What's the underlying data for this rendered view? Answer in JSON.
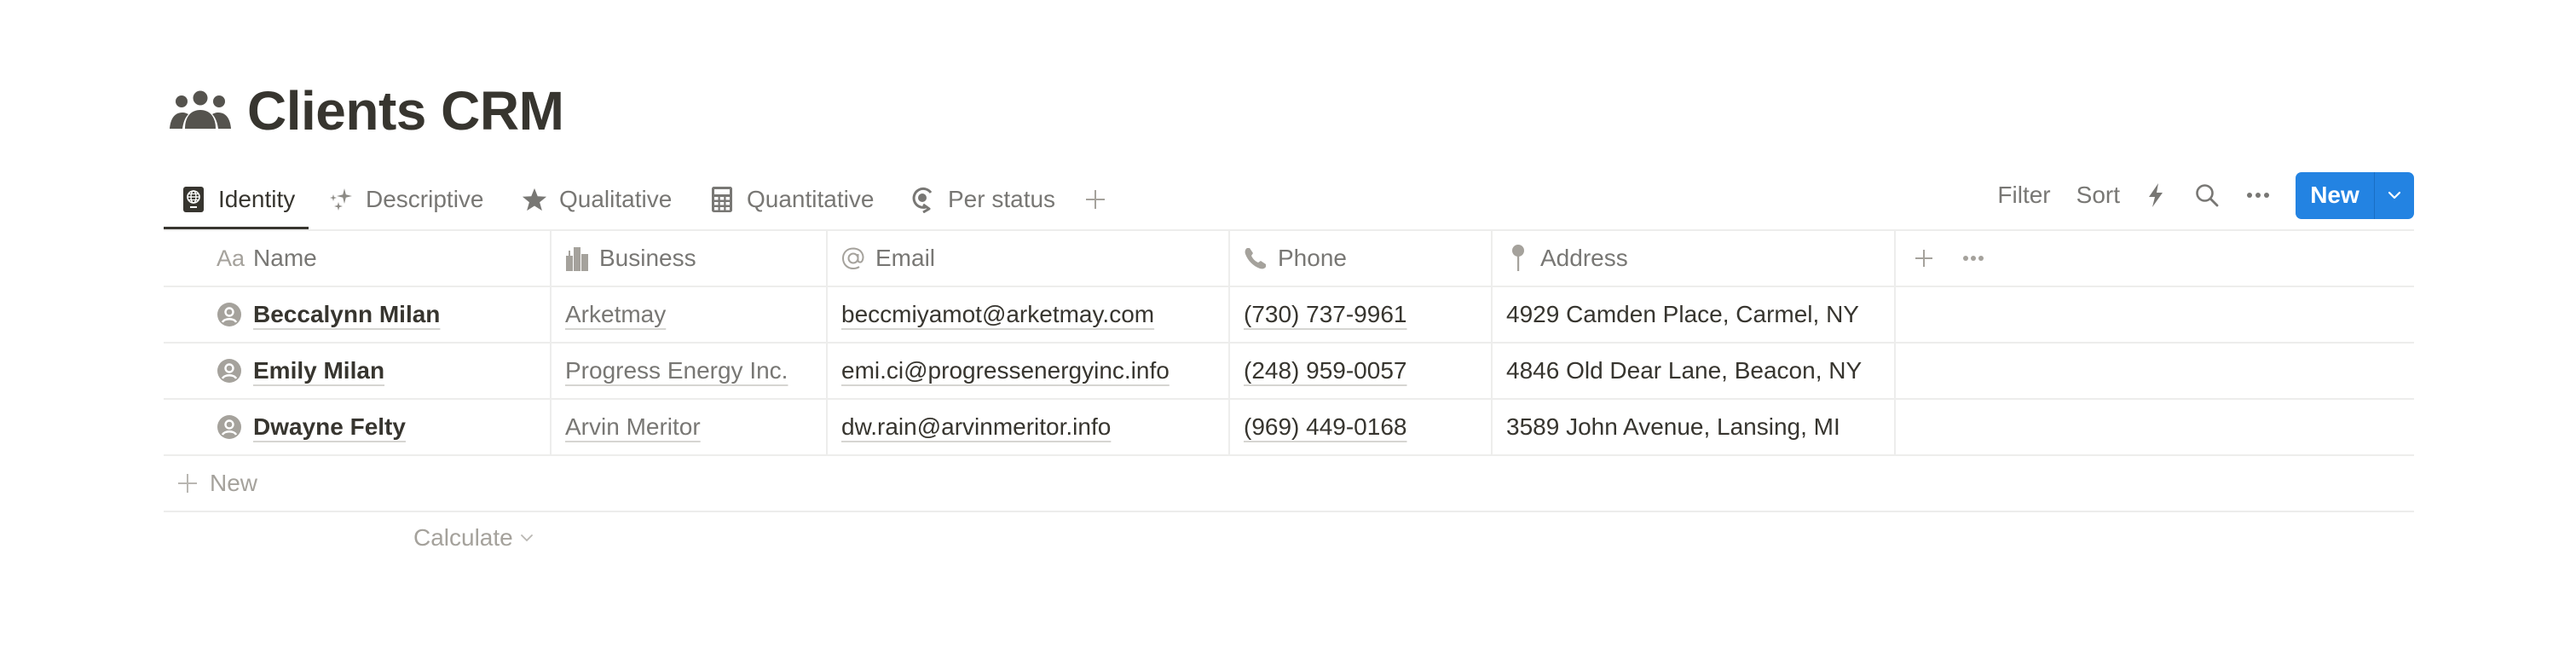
{
  "page": {
    "title": "Clients CRM",
    "title_icon": "people-group-icon"
  },
  "tabs": [
    {
      "label": "Identity",
      "icon": "passport-icon",
      "active": true
    },
    {
      "label": "Descriptive",
      "icon": "sparkles-icon",
      "active": false
    },
    {
      "label": "Qualitative",
      "icon": "star-icon",
      "active": false
    },
    {
      "label": "Quantitative",
      "icon": "calculator-icon",
      "active": false
    },
    {
      "label": "Per status",
      "icon": "status-cycle-icon",
      "active": false
    }
  ],
  "toolbar": {
    "filter_label": "Filter",
    "sort_label": "Sort",
    "automation_icon": "lightning-icon",
    "search_icon": "search-icon",
    "more_icon": "ellipsis-icon",
    "new_label": "New",
    "new_dropdown_icon": "chevron-down-icon",
    "accent_color": "#2383e2"
  },
  "table": {
    "columns": [
      {
        "label": "Name",
        "icon": "Aa"
      },
      {
        "label": "Business",
        "icon": "building-icon"
      },
      {
        "label": "Email",
        "icon": "at-sign-icon"
      },
      {
        "label": "Phone",
        "icon": "phone-icon"
      },
      {
        "label": "Address",
        "icon": "pin-icon"
      }
    ],
    "rows": [
      {
        "name": "Beccalynn Milan",
        "business": "Arketmay",
        "email": "beccmiyamot@arketmay.com",
        "phone": "(730) 737-9961",
        "address": "4929 Camden Place, Carmel, NY"
      },
      {
        "name": "Emily Milan",
        "business": "Progress Energy Inc.",
        "email": "emi.ci@progressenergyinc.info",
        "phone": "(248) 959-0057",
        "address": "4846 Old Dear Lane, Beacon, NY"
      },
      {
        "name": "Dwayne Felty",
        "business": "Arvin Meritor",
        "email": "dw.rain@arvinmeritor.info",
        "phone": "(969) 449-0168",
        "address": "3589 John Avenue, Lansing, MI"
      }
    ],
    "new_row_label": "New",
    "calculate_label": "Calculate"
  }
}
